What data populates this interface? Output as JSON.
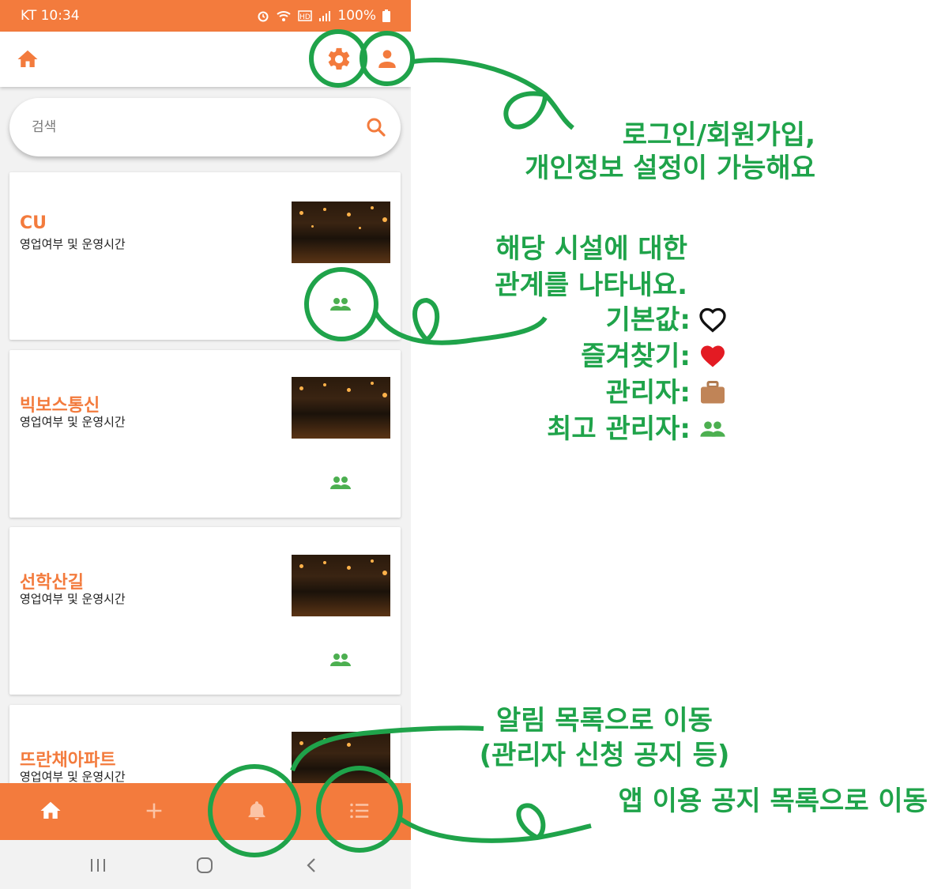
{
  "status_bar": {
    "carrier_time": "KT 10:34",
    "battery": "100%"
  },
  "app_bar": {
    "home_icon": "home-icon",
    "settings_icon": "gear-icon",
    "account_icon": "person-icon"
  },
  "search": {
    "placeholder": "검색",
    "icon": "search-icon"
  },
  "cards": [
    {
      "name": "CU",
      "hours": "영업여부 및 운영시간",
      "relation_icon": "super-admin-icon"
    },
    {
      "name": "빅보스통신",
      "hours": "영업여부 및 운영시간",
      "relation_icon": "super-admin-icon"
    },
    {
      "name": "선학산길",
      "hours": "영업여부 및 운영시간",
      "relation_icon": "super-admin-icon"
    },
    {
      "name": "뜨란채아파트",
      "hours": "영업여부 및 운영시간",
      "relation_icon": "super-admin-icon"
    }
  ],
  "bottom_nav": {
    "items": [
      "home-icon",
      "plus-icon",
      "bell-icon",
      "list-icon"
    ]
  },
  "annotations": {
    "account": [
      "로그인/회원가입,",
      "개인정보 설정이 가능해요"
    ],
    "relation": [
      "해당 시설에 대한",
      "관계를 나타내요."
    ],
    "legend": [
      {
        "label": "기본값:",
        "icon": "heart-outline-icon"
      },
      {
        "label": "즐겨찾기:",
        "icon": "red-heart-icon"
      },
      {
        "label": "관리자:",
        "icon": "briefcase-icon"
      },
      {
        "label": "최고 관리자:",
        "icon": "super-admin-icon"
      }
    ],
    "notifications": [
      "알림 목록으로 이동",
      "(관리자 신청 공지 등)"
    ],
    "app_notices": "앱 이용 공지 목록으로 이동"
  },
  "colors": {
    "brand": "#f37b3d",
    "annotation": "#1fa34a",
    "relation_icon": "#4caf50"
  }
}
